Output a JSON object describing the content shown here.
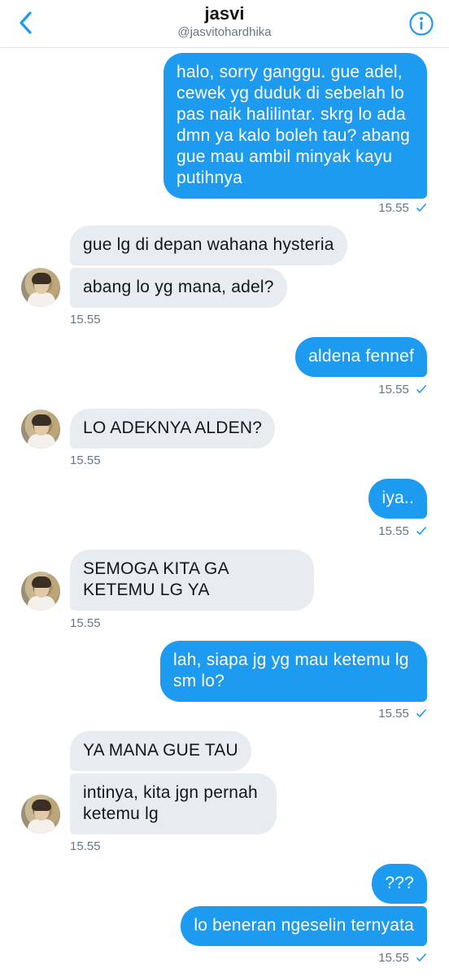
{
  "header": {
    "name": "jasvi",
    "handle": "@jasvitohardhika",
    "back_icon": "chevron-left-icon",
    "info_icon": "info-icon",
    "accent": "#1d9bf0"
  },
  "messages": [
    {
      "id": "m1",
      "dir": "out",
      "text": "halo, sorry ganggu. gue adel, cewek yg duduk di sebelah lo pas naik halilintar. skrg lo ada dmn ya kalo boleh tau? abang gue mau ambil minyak kayu putihnya"
    },
    {
      "id": "t1",
      "time": "15.55"
    },
    {
      "id": "m2",
      "dir": "in",
      "text": "gue lg di depan wahana hysteria"
    },
    {
      "id": "m3",
      "dir": "in",
      "text": "abang lo yg mana, adel?"
    },
    {
      "id": "t2",
      "time": "15.55"
    },
    {
      "id": "m4",
      "dir": "out",
      "text": "aldena fennef"
    },
    {
      "id": "t3",
      "time": "15.55"
    },
    {
      "id": "m5",
      "dir": "in",
      "text": "LO ADEKNYA ALDEN?"
    },
    {
      "id": "t4",
      "time": "15.55"
    },
    {
      "id": "m6",
      "dir": "out",
      "text": "iya.."
    },
    {
      "id": "t5",
      "time": "15.55"
    },
    {
      "id": "m7",
      "dir": "in",
      "text": "SEMOGA KITA GA KETEMU LG YA"
    },
    {
      "id": "t6",
      "time": "15.55"
    },
    {
      "id": "m8",
      "dir": "out",
      "text": "lah, siapa jg yg mau ketemu lg sm lo?"
    },
    {
      "id": "t7",
      "time": "15.55"
    },
    {
      "id": "m9",
      "dir": "in",
      "text": "YA MANA GUE TAU"
    },
    {
      "id": "m10",
      "dir": "in",
      "text": "intinya, kita jgn pernah ketemu lg"
    },
    {
      "id": "t8",
      "time": "15.55"
    },
    {
      "id": "m11",
      "dir": "out",
      "text": "???"
    },
    {
      "id": "m12",
      "dir": "out",
      "text": "lo beneran ngeselin ternyata"
    },
    {
      "id": "t9",
      "time": "15.55"
    }
  ],
  "colors": {
    "outgoing_bubble": "#1d9bf0",
    "incoming_bubble": "#e6ecf0",
    "timestamp": "#657786"
  }
}
